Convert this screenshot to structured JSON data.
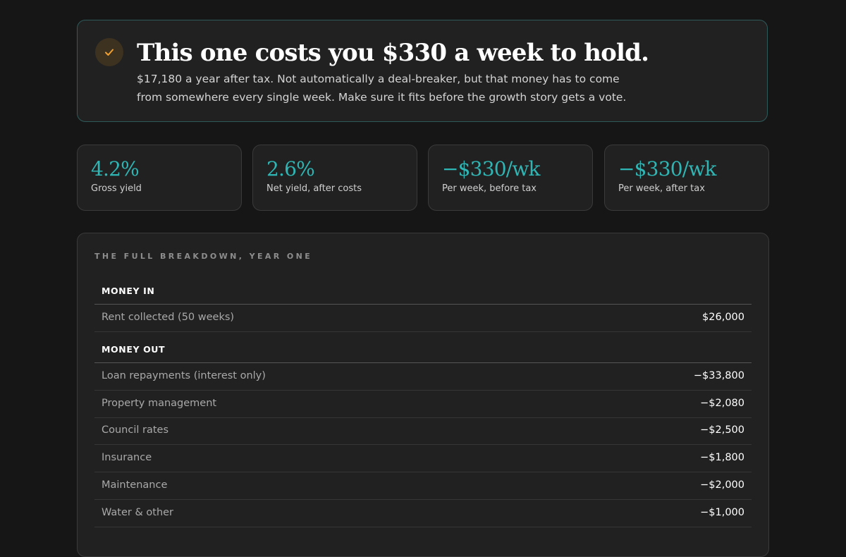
{
  "verdict": {
    "icon": "check-icon",
    "accent": "#f0a030",
    "title": "This one costs you $330 a week to hold.",
    "body": "$17,180 a year after tax. Not automatically a deal-breaker, but that money has to come from somewhere every single week. Make sure it fits before the growth story gets a vote."
  },
  "stats": [
    {
      "value": "4.2%",
      "label": "Gross yield"
    },
    {
      "value": "2.6%",
      "label": "Net yield, after costs"
    },
    {
      "value": "−$330/wk",
      "label": "Per week, before tax"
    },
    {
      "value": "−$330/wk",
      "label": "Per week, after tax"
    }
  ],
  "breakdown": {
    "heading": "THE FULL BREAKDOWN, YEAR ONE",
    "money_in": {
      "title": "MONEY IN",
      "rows": [
        {
          "label": "Rent collected (50 weeks)",
          "amount": "$26,000"
        }
      ]
    },
    "money_out": {
      "title": "MONEY OUT",
      "rows": [
        {
          "label": "Loan repayments (interest only)",
          "amount": "−$33,800"
        },
        {
          "label": "Property management",
          "amount": "−$2,080"
        },
        {
          "label": "Council rates",
          "amount": "−$2,500"
        },
        {
          "label": "Insurance",
          "amount": "−$1,800"
        },
        {
          "label": "Maintenance",
          "amount": "−$2,000"
        },
        {
          "label": "Water & other",
          "amount": "−$1,000"
        }
      ]
    }
  },
  "colors": {
    "accent_teal": "#2fb5b3",
    "check_gold": "#f0a030",
    "background": "#161616",
    "card": "#212121"
  }
}
